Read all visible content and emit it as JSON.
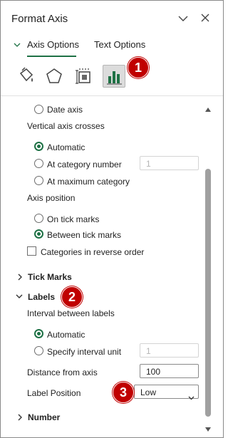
{
  "header": {
    "title": "Format Axis",
    "collapse_icon": "chevron-down-icon",
    "close_icon": "close-icon"
  },
  "tabs": [
    {
      "label": "Axis Options",
      "selected": true
    },
    {
      "label": "Text Options",
      "selected": false
    }
  ],
  "icon_tabs": [
    {
      "name": "fill-line-icon",
      "selected": false
    },
    {
      "name": "effects-pentagon-icon",
      "selected": false
    },
    {
      "name": "size-properties-icon",
      "selected": false
    },
    {
      "name": "axis-options-chart-icon",
      "selected": true
    }
  ],
  "callouts": [
    "1",
    "2",
    "3"
  ],
  "axis_type": {
    "date_axis_label": "Date axis"
  },
  "vertical_crosses": {
    "heading": "Vertical axis crosses",
    "automatic": "Automatic",
    "at_category_number": "At category number",
    "category_number_value": "1",
    "at_maximum": "At maximum category"
  },
  "axis_position": {
    "heading": "Axis position",
    "on_tick_marks": "On tick marks",
    "between_tick_marks": "Between tick marks",
    "reverse_order": "Categories in reverse order"
  },
  "sections": {
    "tick_marks": "Tick Marks",
    "labels": "Labels",
    "number": "Number"
  },
  "labels": {
    "interval_heading": "Interval between labels",
    "automatic": "Automatic",
    "specify_interval": "Specify interval unit",
    "interval_value": "1",
    "distance_label": "Distance from axis",
    "distance_value": "100",
    "position_label": "Label Position",
    "position_value": "Low"
  },
  "colors": {
    "accent": "#1e7145",
    "callout": "#c00000"
  }
}
